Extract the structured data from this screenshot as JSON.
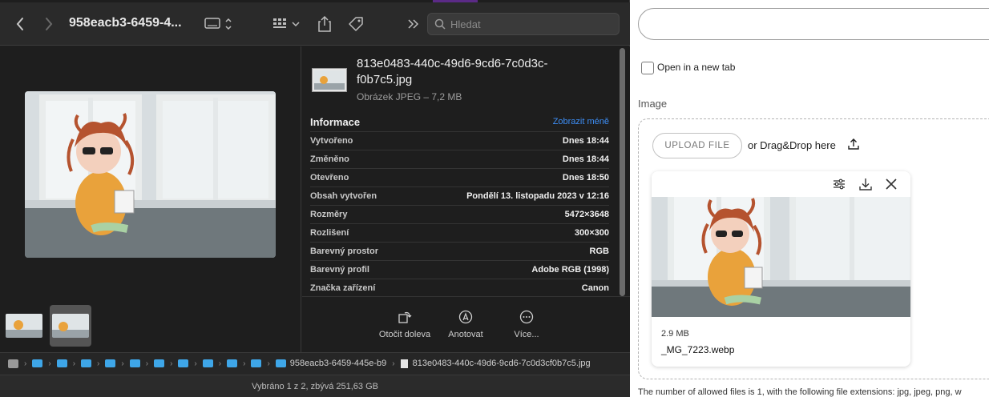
{
  "finder": {
    "title": "958eacb3-6459-4...",
    "search_placeholder": "Hledat",
    "file": {
      "name": "813e0483-440c-49d6-9cd6-7c0d3c-f0b7c5.jpg",
      "kind": "Obrázek JPEG – 7,2 MB"
    },
    "info_heading": "Informace",
    "show_less": "Zobrazit méně",
    "info_rows": [
      {
        "key": "Vytvořeno",
        "value": "Dnes 18:44"
      },
      {
        "key": "Změněno",
        "value": "Dnes 18:44"
      },
      {
        "key": "Otevřeno",
        "value": "Dnes 18:50"
      },
      {
        "key": "Obsah vytvořen",
        "value": "Pondělí 13. listopadu 2023 v 12:16"
      },
      {
        "key": "Rozměry",
        "value": "5472×3648"
      },
      {
        "key": "Rozlišení",
        "value": "300×300"
      },
      {
        "key": "Barevný prostor",
        "value": "RGB"
      },
      {
        "key": "Barevný profil",
        "value": "Adobe RGB (1998)"
      },
      {
        "key": "Značka zařízení",
        "value": "Canon"
      }
    ],
    "actions": {
      "rotate": "Otočit doleva",
      "annotate": "Anotovat",
      "more": "Více..."
    },
    "path": {
      "folder": "958eacb3-6459-445e-b9",
      "file": "813e0483-440c-49d6-9cd6-7c0d3cf0b7c5.jpg"
    },
    "status": "Vybráno 1 z 2, zbývá 251,63 GB"
  },
  "form": {
    "checkbox_label": "Open in a new tab",
    "image_label": "Image",
    "upload_button": "UPLOAD FILE",
    "drag_drop": "or Drag&Drop here",
    "uploaded": {
      "size": "2.9 MB",
      "name": "_MG_7223.webp"
    },
    "footnote": "The number of allowed files is 1, with the following file extensions: jpg, jpeg, png, w"
  },
  "colors": {
    "finder_bg": "#1e1e1e",
    "link_blue": "#3d8ef5",
    "folder_blue": "#3ea6e8"
  }
}
